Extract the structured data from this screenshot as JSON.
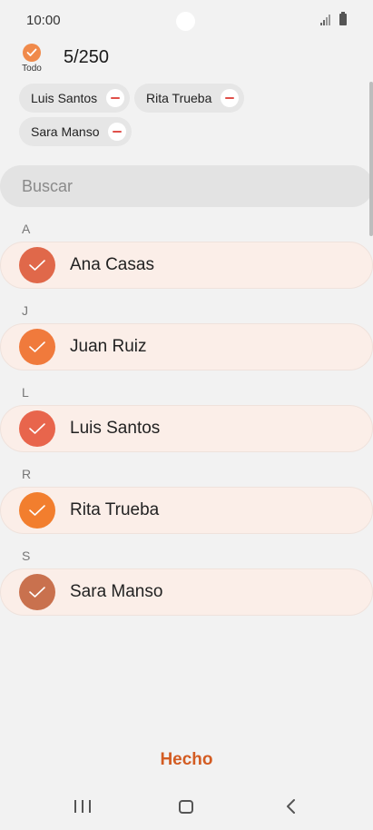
{
  "status_bar": {
    "time": "10:00"
  },
  "header": {
    "select_all_label": "Todo",
    "count": "5/250"
  },
  "chips": [
    {
      "label": "Luis Santos"
    },
    {
      "label": "Rita Trueba"
    },
    {
      "label": "Sara Manso"
    }
  ],
  "search": {
    "placeholder": "Buscar"
  },
  "sections": [
    {
      "letter": "A",
      "name": "Ana Casas",
      "color": "#e0684a"
    },
    {
      "letter": "J",
      "name": "Juan Ruiz",
      "color": "#f07a3c"
    },
    {
      "letter": "L",
      "name": "Luis Santos",
      "color": "#e8654c"
    },
    {
      "letter": "R",
      "name": "Rita Trueba",
      "color": "#f27e2e"
    },
    {
      "letter": "S",
      "name": "Sara Manso",
      "color": "#c9714e"
    }
  ],
  "footer": {
    "done_label": "Hecho"
  },
  "colors": {
    "accent": "#d35c22",
    "check_orange": "#f08a4b",
    "row_bg": "#fbeee8"
  }
}
